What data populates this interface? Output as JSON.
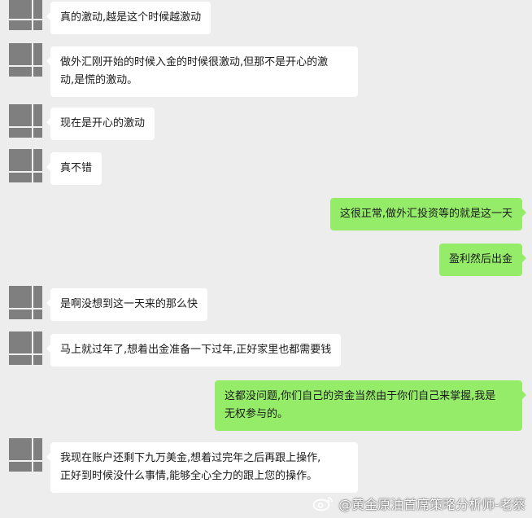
{
  "chat": {
    "messages": [
      {
        "side": "left",
        "text": "真的激动,越是这个时候越激动"
      },
      {
        "side": "left",
        "lines": [
          "做外汇刚开始的时候入金的时候很激动,但那不是开心的激",
          "动,是慌的激动。"
        ]
      },
      {
        "side": "left",
        "text": "现在是开心的激动"
      },
      {
        "side": "left",
        "text": "真不错"
      },
      {
        "side": "right",
        "text": "这很正常,做外汇投资等的就是这一天"
      },
      {
        "side": "right",
        "text": "盈利然后出金"
      },
      {
        "side": "left",
        "text": "是啊没想到这一天来的那么快"
      },
      {
        "side": "left",
        "text": "马上就过年了,想着出金准备一下过年,正好家里也都需要钱"
      },
      {
        "side": "right",
        "lines": [
          "这都没问题,你们自己的资金当然由于你们自己来掌握,我是",
          "无权参与的。"
        ]
      },
      {
        "side": "left",
        "lines": [
          "我现在账户还剩下九万美金,想着过完年之后再跟上操作,",
          "正好到时候没什么事情,能够全心全力的跟上您的操作。"
        ]
      }
    ]
  },
  "watermark": {
    "text": "@黄金原油首席策略分析师-老蔡",
    "icon": "weibo-icon"
  },
  "colors": {
    "background": "#ededed",
    "incoming_bubble": "#ffffff",
    "outgoing_bubble": "#95ec69"
  }
}
